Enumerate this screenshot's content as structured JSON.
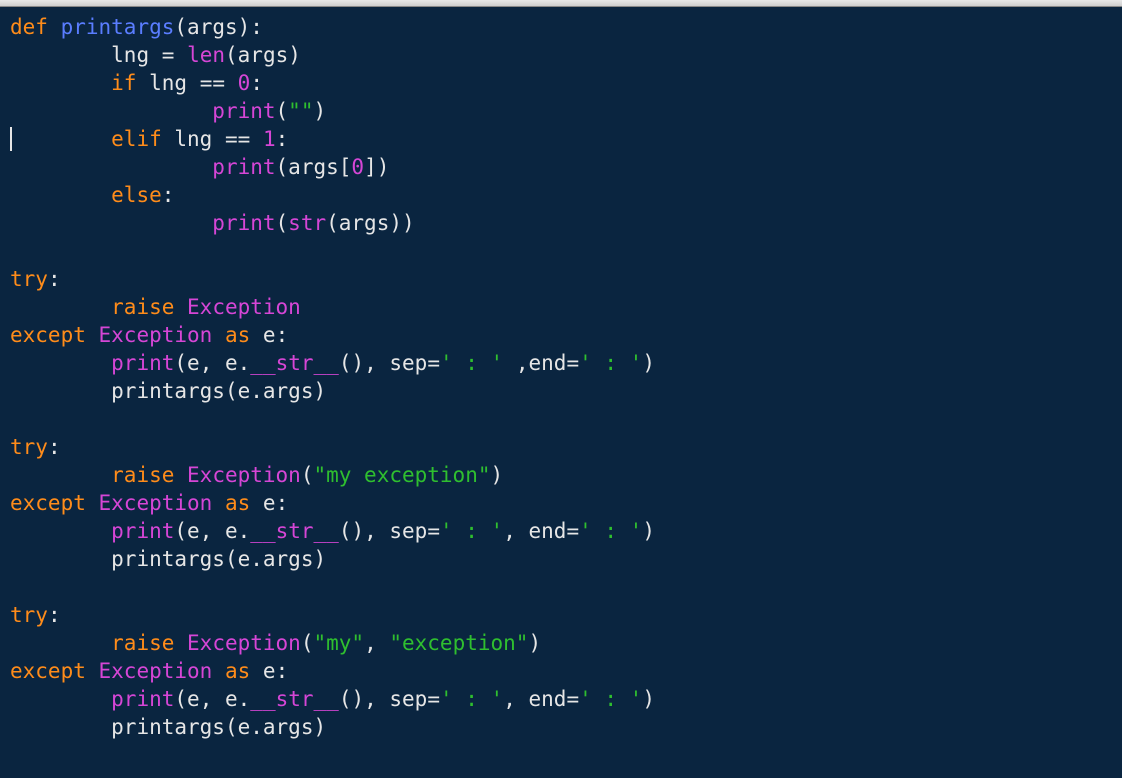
{
  "code": {
    "def": "def",
    "fn_name": "printargs",
    "args_param": "args",
    "lng": "lng",
    "eq": "=",
    "len": "len",
    "if": "if",
    "eqeq": "==",
    "zero": "0",
    "one": "1",
    "elif": "elif",
    "else": "else",
    "print": "print",
    "str_builtin": "str",
    "empty_str": "\"\"",
    "args_sub": "args",
    "idx0": "0",
    "try": "try",
    "raise": "raise",
    "exception": "Exception",
    "except": "except",
    "as": "as",
    "e": "e",
    "dstr": "__str__",
    "sep_kw": "sep",
    "end_kw": "end",
    "sep_val": "' : '",
    "end_val": "' : '",
    "printargs_call": "printargs",
    "e_args": "e.args",
    "my_exception": "\"my exception\"",
    "my": "\"my\"",
    "exception_str": "\"exception\""
  },
  "cursor": {
    "line": 5,
    "col": 0
  }
}
